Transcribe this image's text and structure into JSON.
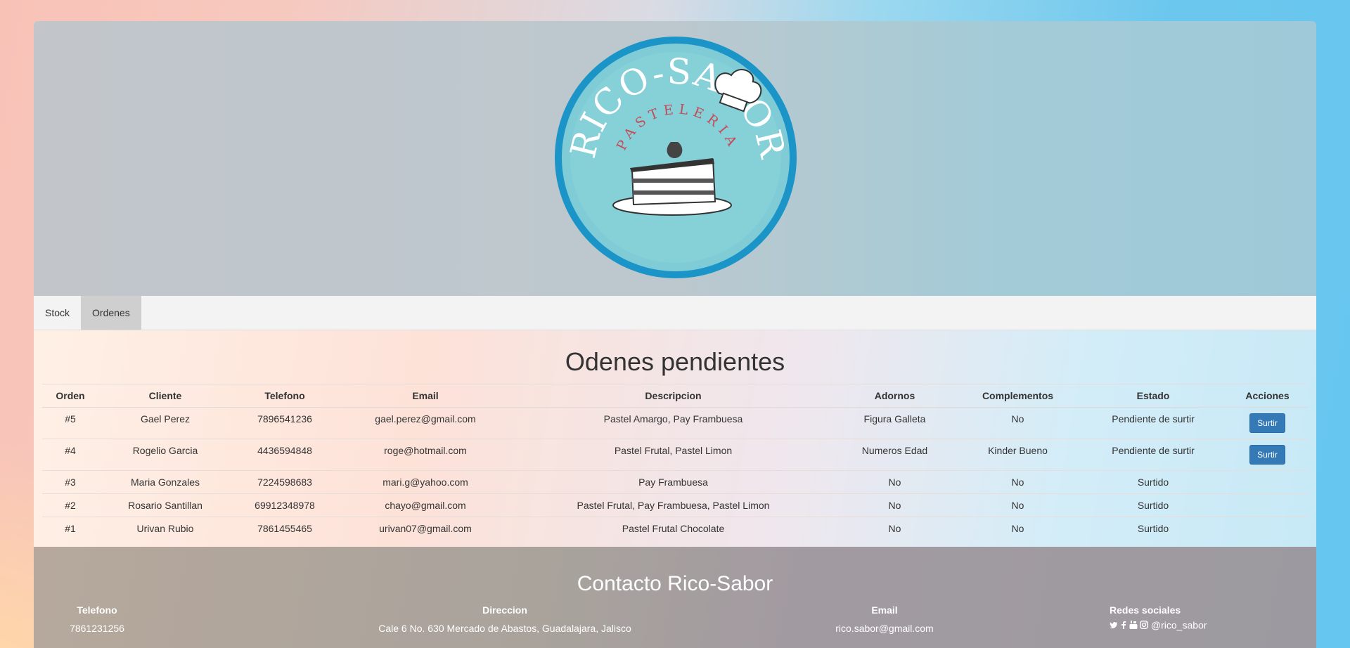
{
  "brand": {
    "logo_title": "RICO-SABOR",
    "logo_subtitle": "PASTELERIA",
    "colors": {
      "logo_blue": "#1b95c8",
      "logo_fill": "#7fccd6",
      "subtitle_red": "#c44b58"
    }
  },
  "nav": {
    "items": [
      {
        "label": "Stock"
      },
      {
        "label": "Ordenes"
      }
    ]
  },
  "orders": {
    "title": "Odenes pendientes",
    "columns": [
      "Orden",
      "Cliente",
      "Telefono",
      "Email",
      "Descripcion",
      "Adornos",
      "Complementos",
      "Estado",
      "Acciones"
    ],
    "action_label": "Surtir",
    "rows": [
      {
        "orden": "#5",
        "cliente": "Gael Perez",
        "telefono": "7896541236",
        "email": "gael.perez@gmail.com",
        "descripcion": "Pastel Amargo, Pay Frambuesa",
        "adornos": "Figura Galleta",
        "complementos": "No",
        "estado": "Pendiente de surtir",
        "accion": "Surtir"
      },
      {
        "orden": "#4",
        "cliente": "Rogelio Garcia",
        "telefono": "4436594848",
        "email": "roge@hotmail.com",
        "descripcion": "Pastel Frutal, Pastel Limon",
        "adornos": "Numeros Edad",
        "complementos": "Kinder Bueno",
        "estado": "Pendiente de surtir",
        "accion": "Surtir"
      },
      {
        "orden": "#3",
        "cliente": "Maria Gonzales",
        "telefono": "7224598683",
        "email": "mari.g@yahoo.com",
        "descripcion": "Pay Frambuesa",
        "adornos": "No",
        "complementos": "No",
        "estado": "Surtido",
        "accion": ""
      },
      {
        "orden": "#2",
        "cliente": "Rosario Santillan",
        "telefono": "69912348978",
        "email": "chayo@gmail.com",
        "descripcion": "Pastel Frutal, Pay Frambuesa, Pastel Limon",
        "adornos": "No",
        "complementos": "No",
        "estado": "Surtido",
        "accion": ""
      },
      {
        "orden": "#1",
        "cliente": "Urivan Rubio",
        "telefono": "7861455465",
        "email": "urivan07@gmail.com",
        "descripcion": "Pastel Frutal Chocolate",
        "adornos": "No",
        "complementos": "No",
        "estado": "Surtido",
        "accion": ""
      }
    ]
  },
  "footer": {
    "title": "Contacto Rico-Sabor",
    "telefono_label": "Telefono",
    "telefono": "7861231256",
    "direccion_label": "Direccion",
    "direccion": "Cale 6 No. 630 Mercado de Abastos, Guadalajara, Jalisco",
    "email_label": "Email",
    "email": "rico.sabor@gmail.com",
    "social_label": "Redes sociales",
    "social_handle": "@rico_sabor",
    "social_icons": [
      "twitter-icon",
      "facebook-icon",
      "youtube-icon",
      "instagram-icon"
    ]
  }
}
